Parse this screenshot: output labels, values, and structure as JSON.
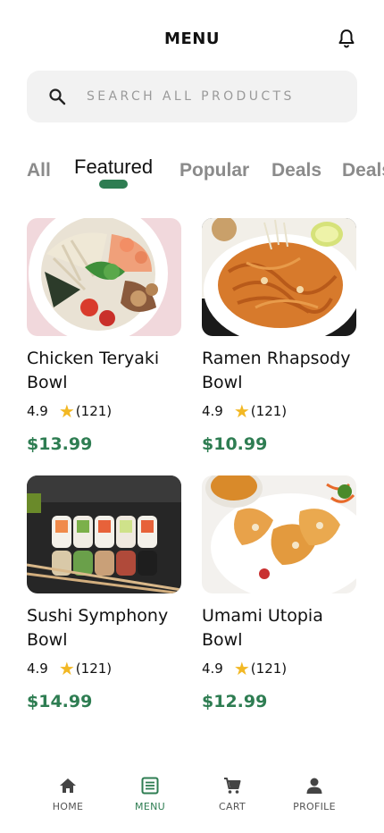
{
  "header": {
    "title": "MENU",
    "bell_icon": "bell-icon"
  },
  "search": {
    "placeholder": "SEARCH ALL PRODUCTS",
    "icon": "search-icon"
  },
  "tabs": [
    {
      "label": "All"
    },
    {
      "label": "Featured",
      "active": true
    },
    {
      "label": "Popular"
    },
    {
      "label": "Deals"
    },
    {
      "label": "Deals"
    }
  ],
  "products": [
    {
      "name": "Chicken Teryaki Bowl",
      "rating": "4.9",
      "reviews": "(121)",
      "price": "$13.99"
    },
    {
      "name": "Ramen Rhapsody Bowl",
      "rating": "4.9",
      "reviews": "(121)",
      "price": "$10.99"
    },
    {
      "name": "Sushi Symphony Bowl",
      "rating": "4.9",
      "reviews": "(121)",
      "price": "$14.99"
    },
    {
      "name": "Umami Utopia Bowl",
      "rating": "4.9",
      "reviews": "(121)",
      "price": "$12.99"
    }
  ],
  "nav": [
    {
      "label": "HOME",
      "icon": "home-icon"
    },
    {
      "label": "MENU",
      "icon": "menu-list-icon",
      "active": true
    },
    {
      "label": "CART",
      "icon": "cart-icon"
    },
    {
      "label": "PROFILE",
      "icon": "person-icon"
    }
  ],
  "colors": {
    "accent": "#2e7d52",
    "star": "#f2b824",
    "search_bg": "#f2f2f2",
    "tab_inactive": "#8b8b8b"
  }
}
